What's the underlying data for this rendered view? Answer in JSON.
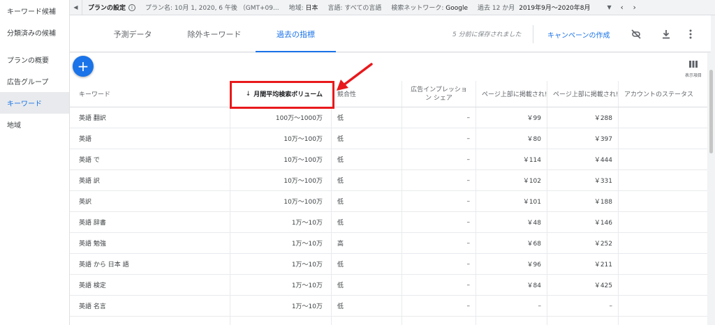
{
  "sidebar": {
    "items": [
      {
        "label": "キーワード候補",
        "active": false
      },
      {
        "label": "分類済みの候補",
        "active": false
      },
      {
        "label": "プランの概要",
        "active": false
      },
      {
        "label": "広告グループ",
        "active": false
      },
      {
        "label": "キーワード",
        "active": true
      },
      {
        "label": "地域",
        "active": false
      }
    ]
  },
  "topbar": {
    "title": "プランの設定",
    "plan_name": "プラン名: 10月 1, 2020, 6 午後 （GMT+09...",
    "location_label": "地域: ",
    "location_value": "日本",
    "language": "言語: すべての言語",
    "network_label": "検索ネットワーク: ",
    "network_value": "Google",
    "period_label": "過去 12 か月",
    "period_value": "2019年9月〜2020年8月"
  },
  "tabs": [
    {
      "label": "予測データ",
      "active": false
    },
    {
      "label": "除外キーワード",
      "active": false
    },
    {
      "label": "過去の指標",
      "active": true
    }
  ],
  "toolbar": {
    "saved_status": "5 分前に保存されました",
    "create_campaign": "キャンペーンの作成",
    "columns_label": "表示項目"
  },
  "table": {
    "headers": {
      "keyword": "キーワード",
      "volume": "月間平均検索ボリューム",
      "competition": "競合性",
      "impression_share": "広告インプレッション シェア",
      "top_bid_low": "ページ上部に掲載され!",
      "top_bid_high": "ページ上部に掲載され!",
      "account_status": "アカウントのステータス"
    },
    "rows": [
      {
        "keyword": "英語 翻訳",
        "volume": "100万～1000万",
        "competition": "低",
        "share": "–",
        "low": "￥99",
        "high": "￥288",
        "status": ""
      },
      {
        "keyword": "英語",
        "volume": "10万～100万",
        "competition": "低",
        "share": "–",
        "low": "￥80",
        "high": "￥397",
        "status": ""
      },
      {
        "keyword": "英語 で",
        "volume": "10万～100万",
        "competition": "低",
        "share": "–",
        "low": "￥114",
        "high": "￥444",
        "status": ""
      },
      {
        "keyword": "英語 訳",
        "volume": "10万～100万",
        "competition": "低",
        "share": "–",
        "low": "￥102",
        "high": "￥331",
        "status": ""
      },
      {
        "keyword": "英訳",
        "volume": "10万～100万",
        "competition": "低",
        "share": "–",
        "low": "￥101",
        "high": "￥188",
        "status": ""
      },
      {
        "keyword": "英語 辞書",
        "volume": "1万～10万",
        "competition": "低",
        "share": "–",
        "low": "￥48",
        "high": "￥146",
        "status": ""
      },
      {
        "keyword": "英語 勉強",
        "volume": "1万～10万",
        "competition": "高",
        "share": "–",
        "low": "￥68",
        "high": "￥252",
        "status": ""
      },
      {
        "keyword": "英語 から 日本 語",
        "volume": "1万～10万",
        "competition": "低",
        "share": "–",
        "low": "￥96",
        "high": "￥211",
        "status": ""
      },
      {
        "keyword": "英語 検定",
        "volume": "1万～10万",
        "competition": "低",
        "share": "–",
        "low": "￥84",
        "high": "￥425",
        "status": ""
      },
      {
        "keyword": "英語 名言",
        "volume": "1万～10万",
        "competition": "低",
        "share": "–",
        "low": "–",
        "high": "–",
        "status": ""
      }
    ]
  },
  "colors": {
    "accent": "#1a73e8",
    "annotation": "#e8191c"
  }
}
